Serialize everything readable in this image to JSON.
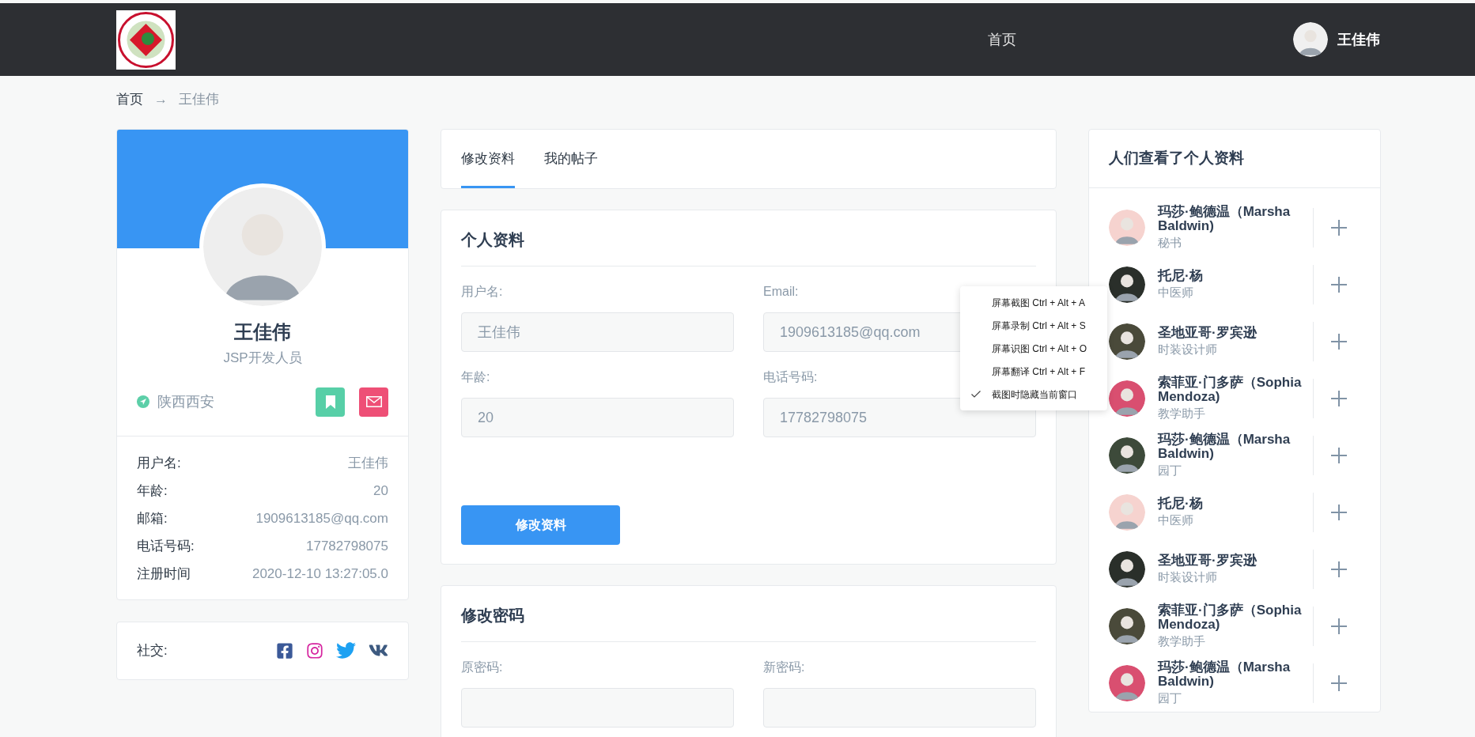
{
  "header": {
    "nav": [
      {
        "label": "首页"
      }
    ],
    "user": {
      "name": "王佳伟"
    }
  },
  "breadcrumb": {
    "separator": "→",
    "items": [
      {
        "label": "首页",
        "current": false
      },
      {
        "label": "王佳伟",
        "current": true
      }
    ]
  },
  "profile": {
    "name": "王佳伟",
    "title": "JSP开发人员",
    "location": "陕西西安",
    "info": [
      {
        "label": "用户名:",
        "value": "王佳伟"
      },
      {
        "label": "年龄:",
        "value": "20"
      },
      {
        "label": "邮箱:",
        "value": "1909613185@qq.com"
      },
      {
        "label": "电话号码:",
        "value": "17782798075"
      },
      {
        "label": "注册时间",
        "value": "2020-12-10 13:27:05.0"
      }
    ],
    "social_label": "社交:"
  },
  "tabs": [
    {
      "label": "修改资料",
      "selected": true
    },
    {
      "label": "我的帖子",
      "selected": false
    }
  ],
  "personal": {
    "title": "个人资料",
    "fields": [
      {
        "label": "用户名:",
        "value": "王佳伟"
      },
      {
        "label": "Email:",
        "value": "1909613185@qq.com"
      },
      {
        "label": "年龄:",
        "value": "20"
      },
      {
        "label": "电话号码:",
        "value": "17782798075"
      }
    ],
    "button": "修改资料"
  },
  "password": {
    "title": "修改密码",
    "fields": [
      {
        "label": "原密码:"
      },
      {
        "label": "新密码:"
      }
    ]
  },
  "viewers": {
    "title": "人们查看了个人资料",
    "people": [
      {
        "name": "玛莎·鲍德温（Marsha Baldwin)",
        "role": "秘书"
      },
      {
        "name": "托尼·杨",
        "role": "中医师"
      },
      {
        "name": "圣地亚哥·罗宾逊",
        "role": "时装设计师"
      },
      {
        "name": "索菲亚·门多萨（Sophia Mendoza)",
        "role": "教学助手"
      },
      {
        "name": "玛莎·鲍德温（Marsha Baldwin)",
        "role": "园丁"
      },
      {
        "name": "托尼·杨",
        "role": "中医师"
      },
      {
        "name": "圣地亚哥·罗宾逊",
        "role": "时装设计师"
      },
      {
        "name": "索菲亚·门多萨（Sophia Mendoza)",
        "role": "教学助手"
      },
      {
        "name": "玛莎·鲍德温（Marsha Baldwin)",
        "role": "园丁"
      }
    ]
  },
  "context_menu": {
    "items": [
      {
        "label": "屏幕截图 Ctrl + Alt + A",
        "checked": false
      },
      {
        "label": "屏幕录制 Ctrl + Alt + S",
        "checked": false
      },
      {
        "label": "屏幕识图 Ctrl + Alt + O",
        "checked": false
      },
      {
        "label": "屏幕翻译 Ctrl + Alt + F",
        "checked": false
      },
      {
        "label": "截图时隐藏当前窗口",
        "checked": true
      }
    ]
  }
}
